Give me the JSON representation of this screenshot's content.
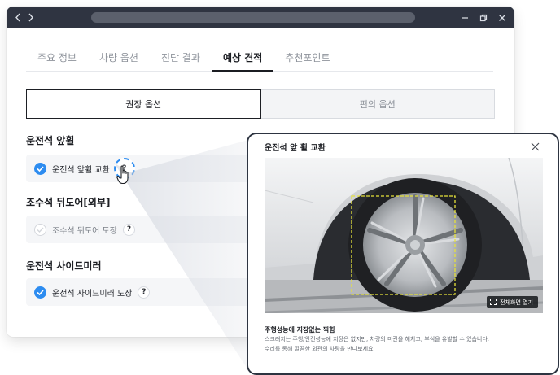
{
  "tabs": [
    {
      "label": "주요 정보",
      "active": false
    },
    {
      "label": "차량 옵션",
      "active": false
    },
    {
      "label": "진단 결과",
      "active": false
    },
    {
      "label": "예상 견적",
      "active": true
    },
    {
      "label": "추천포인트",
      "active": false
    }
  ],
  "segment": {
    "recommended": "권장 옵션",
    "convenience": "편의 옵션",
    "selected": "recommended"
  },
  "sections": [
    {
      "title": "운전석 앞휠",
      "option": {
        "label": "운전석 앞휠 교환",
        "checked": true,
        "help": "?"
      }
    },
    {
      "title": "조수석 뒤도어[외부]",
      "option": {
        "label": "조수석 뒤도어 도장",
        "checked": false,
        "help": "?"
      }
    },
    {
      "title": "운전석 사이드미러",
      "option": {
        "label": "운전석 사이드미러 도장",
        "checked": true,
        "help": "?"
      }
    }
  ],
  "popup": {
    "title": "운전석 앞 휠 교환",
    "fullscreen_label": "전체화면 열기",
    "desc_title": "주행성능에 지장없는 찍힘",
    "desc_line1": "스크래치는 주행/안전성능에 지장은 없지만, 차량의 미관을 해치고, 부식을 유발할 수 있습니다.",
    "desc_line2": "수리를 통해 깔끔한 외관의 차량을 만나보세요."
  },
  "colors": {
    "accent": "#2d8cf0",
    "titlebar": "#2f3441",
    "highlight_box": "#e6e23a"
  },
  "icons": {
    "back": "chevron-left-icon",
    "forward": "chevron-right-icon",
    "minimize": "minimize-icon",
    "restore": "restore-icon",
    "close": "close-icon",
    "check": "check-icon",
    "help": "question-icon",
    "cursor": "hand-pointer-icon",
    "fullscreen": "fullscreen-icon"
  }
}
